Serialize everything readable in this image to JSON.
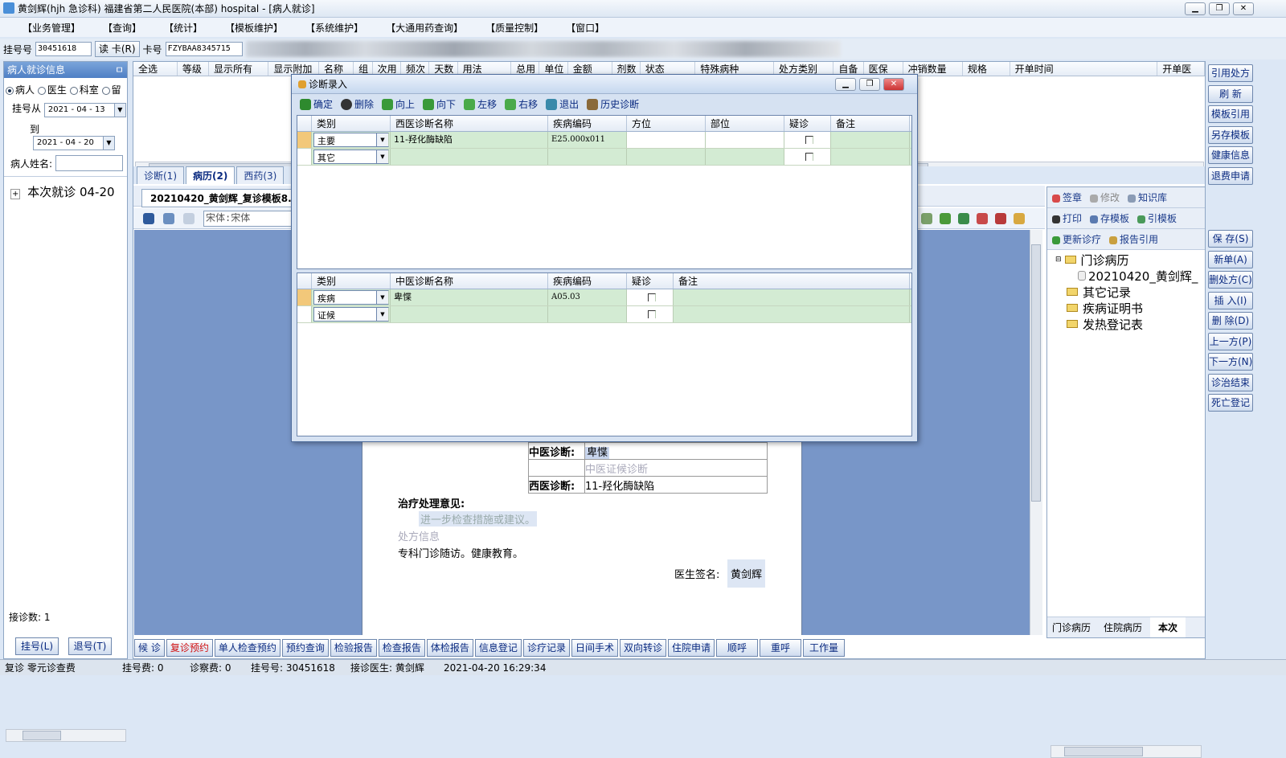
{
  "window": {
    "title": "黄剑辉(hjh 急诊科) 福建省第二人民医院(本部) hospital - [病人就诊]",
    "controls": [
      "▁",
      "❐",
      "✕"
    ]
  },
  "menu": [
    "【业务管理】",
    "【查询】",
    "【统计】",
    "【模板维护】",
    "【系统维护】",
    "【大通用药查询】",
    "【质量控制】",
    "【窗口】"
  ],
  "toolbar": {
    "reg_no_label": "挂号号",
    "reg_no_value": "30451618",
    "read_card_label": "读 卡(R)",
    "card_no_label": "卡号",
    "card_no_value": "FZYBAA8345715"
  },
  "left_panel": {
    "title": "病人就诊信息",
    "pin": "ㅁ",
    "radios": [
      "病人",
      "医生",
      "科室",
      "留"
    ],
    "date_from_label": "挂号从",
    "date_from": "2021 - 04 - 13",
    "date_to_label": "到",
    "date_to": "2021 - 04 - 20",
    "patient_name_label": "病人姓名:",
    "tree_item": "本次就诊  04-20",
    "count_label": "接诊数: 1",
    "btn_register": "挂号(L)",
    "btn_unregister": "退号(T)"
  },
  "order_grid": {
    "headers": [
      "全选",
      "等级",
      "显示所有",
      "显示附加",
      "名称",
      "组",
      "次用",
      "频次",
      "天数",
      "用法",
      "总用",
      "单位",
      "金额",
      "剂数",
      "状态",
      "特殊病种",
      "处方类别",
      "自备",
      "医保",
      "冲销数量",
      "规格",
      "开单时间",
      "开单医"
    ]
  },
  "tabs": [
    "诊断(1)",
    "病历(2)",
    "西药(3)"
  ],
  "doc_tab": "20210420_黄剑辉_复诊模板8.1",
  "font_box": "宋体:宋体",
  "document": {
    "tcm_diag_label": "中医诊断:",
    "tcm_diag_value": "卑惵",
    "tcm_syndrome_placeholder": "中医证候诊断",
    "wm_diag_label": "西医诊断:",
    "wm_diag_value": "11-羟化酶缺陷",
    "treatment_label": "治疗处理意见:",
    "treatment_placeholder": "进一步检查措施或建议。",
    "prescription_placeholder": "处方信息",
    "advice": "专科门诊随访。健康教育。",
    "doctor_sign_label": "医生签名:",
    "doctor_sign_value": "黄剑辉"
  },
  "right_panel": {
    "tool1": [
      "签章",
      "修改",
      "知识库"
    ],
    "tool2": [
      "打印",
      "存模板",
      "引模板"
    ],
    "tool3": [
      "更新诊疗",
      "报告引用"
    ],
    "tree": {
      "root": "门诊病历",
      "child": "20210420_黄剑辉_",
      "items": [
        "其它记录",
        "疾病证明书",
        "发热登记表"
      ]
    },
    "bottom_tabs": [
      "门诊病历",
      "住院病历",
      "本次"
    ]
  },
  "side_buttons": [
    "引用处方",
    "刷 新",
    "模板引用",
    "另存模板",
    "健康信息",
    "退费申请",
    "保 存(S)",
    "新单(A)",
    "删处方(C)",
    "插 入(I)",
    "删 除(D)",
    "上一方(P)",
    "下一方(N)",
    "诊治结束",
    "死亡登记"
  ],
  "bottom_buttons": [
    "候 诊",
    "复诊预约",
    "单人检查预约",
    "预约查询",
    "检验报告",
    "检查报告",
    "体检报告",
    "信息登记",
    "诊疗记录",
    "日间手术",
    "双向转诊",
    "住院申请",
    "顺呼",
    "重呼",
    "工作量"
  ],
  "status_bar": [
    "复诊 零元诊查费",
    "挂号费: 0",
    "诊察费: 0",
    "挂号号: 30451618",
    "接诊医生: 黄剑辉",
    "2021-04-20 16:29:34"
  ],
  "dialog": {
    "title": "诊断录入",
    "toolbar": [
      "确定",
      "删除",
      "向上",
      "向下",
      "左移",
      "右移",
      "退出",
      "历史诊断"
    ],
    "wm_headers": [
      "类别",
      "西医诊断名称",
      "疾病编码",
      "方位",
      "部位",
      "疑诊",
      "备注"
    ],
    "wm_rows": [
      {
        "type": "主要",
        "name": "11-羟化酶缺陷",
        "code": "E25.000x011"
      },
      {
        "type": "其它",
        "name": "",
        "code": ""
      }
    ],
    "tcm_headers": [
      "类别",
      "中医诊断名称",
      "疾病编码",
      "疑诊",
      "备注"
    ],
    "tcm_rows": [
      {
        "type": "疾病",
        "name": "卑惵",
        "code": "A05.03"
      },
      {
        "type": "证候",
        "name": "",
        "code": ""
      }
    ]
  },
  "colors": {
    "accent": "#4f7fc4",
    "row_green": "#d3ebd3",
    "row_indicator": "#f2c87a",
    "doc_background": "#7896c8"
  }
}
